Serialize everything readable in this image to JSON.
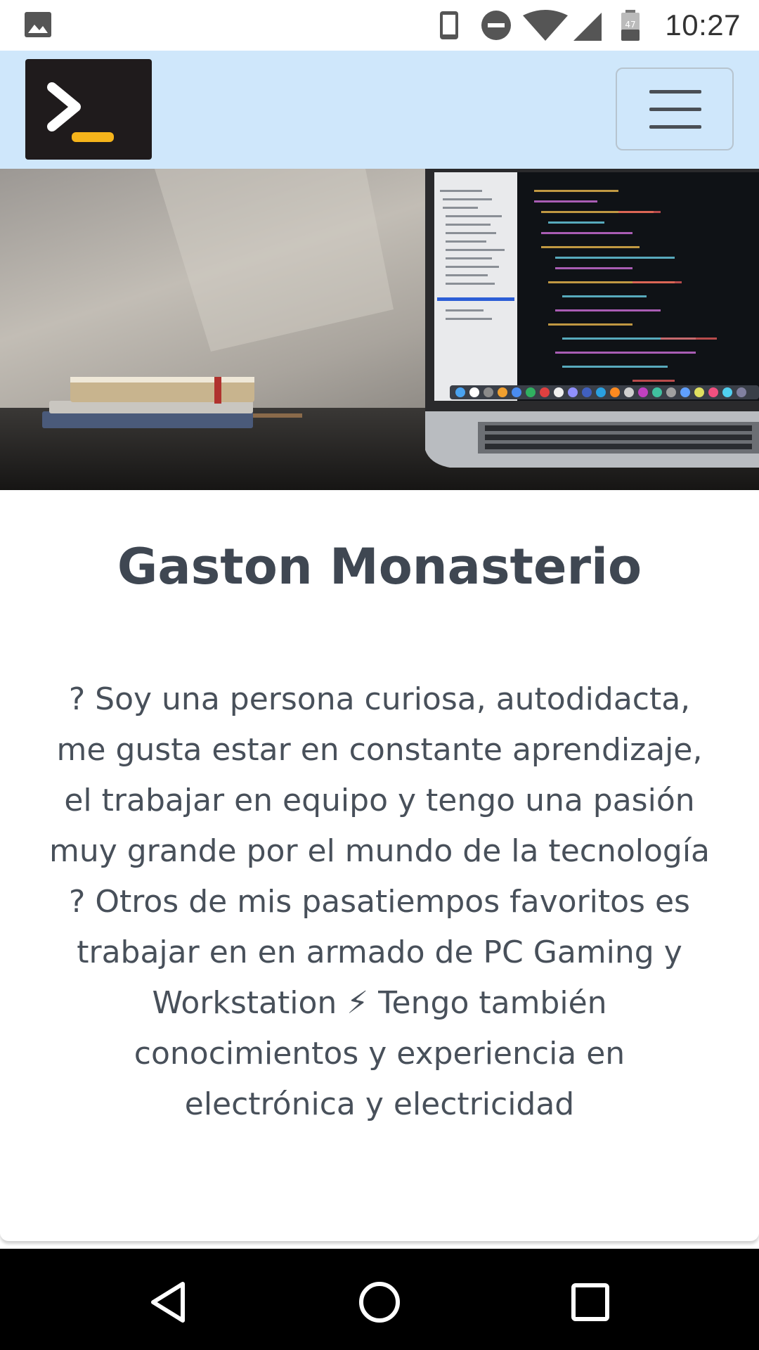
{
  "status_bar": {
    "time": "10:27",
    "battery_level": "47",
    "icons": [
      "gallery-icon",
      "phone-icon",
      "do-not-disturb-icon",
      "wifi-icon",
      "cell-signal-icon",
      "battery-icon"
    ]
  },
  "navbar": {
    "logo_icon": "terminal-prompt-icon",
    "logo_colors": {
      "background": "#1f1b1c",
      "chevron": "#ffffff",
      "underscore": "#f5b41b"
    },
    "menu_icon": "hamburger-menu-icon",
    "background": "#cfe7fb"
  },
  "hero": {
    "image_icon": "desk-laptop-photo"
  },
  "profile": {
    "name": "Gaston Monasterio",
    "bio_lines": [
      "? Soy una persona curiosa, autodidacta,",
      "me gusta estar en constante aprendizaje,",
      "el trabajar en equipo y tengo una pasión",
      "muy grande por el mundo de la tecnología",
      "? Otros de mis pasatiempos favoritos es",
      "trabajar en en armado de PC Gaming y",
      "Workstation ⚡ Tengo también",
      "conocimientos y experiencia en",
      "electrónica y electricidad"
    ]
  },
  "system_nav": {
    "buttons": [
      "back-icon",
      "home-icon",
      "recents-icon"
    ]
  }
}
